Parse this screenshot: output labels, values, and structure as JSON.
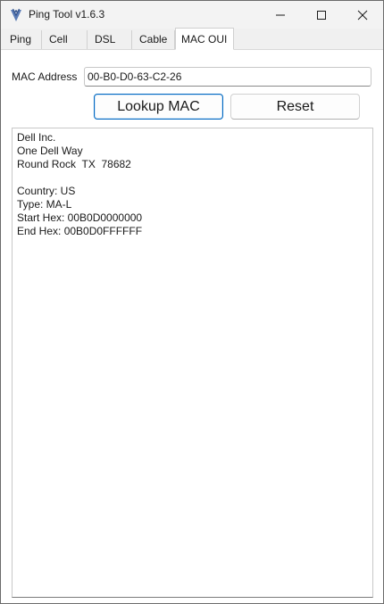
{
  "window": {
    "title": "Ping Tool v1.6.3",
    "icon": "app-logo-icon",
    "controls": [
      "minimize-icon",
      "maximize-icon",
      "close-icon"
    ]
  },
  "tabs": [
    {
      "label": "Ping",
      "active": false
    },
    {
      "label": "Cell",
      "active": false
    },
    {
      "label": "DSL",
      "active": false
    },
    {
      "label": "Cable",
      "active": false
    },
    {
      "label": "MAC OUI",
      "active": true
    }
  ],
  "mac_form": {
    "label": "MAC Address",
    "value": "00-B0-D0-63-C2-26",
    "lookup_button": "Lookup MAC",
    "reset_button": "Reset"
  },
  "result": {
    "lines": [
      "Dell Inc.",
      "One Dell Way",
      "Round Rock  TX  78682",
      "",
      "Country: US",
      "Type: MA-L",
      "Start Hex: 00B0D0000000",
      "End Hex: 00B0D0FFFFFF"
    ]
  },
  "colors": {
    "accent": "#0067c0",
    "titlebar": "#f3f3f3",
    "icon": "#5a7bb5"
  }
}
